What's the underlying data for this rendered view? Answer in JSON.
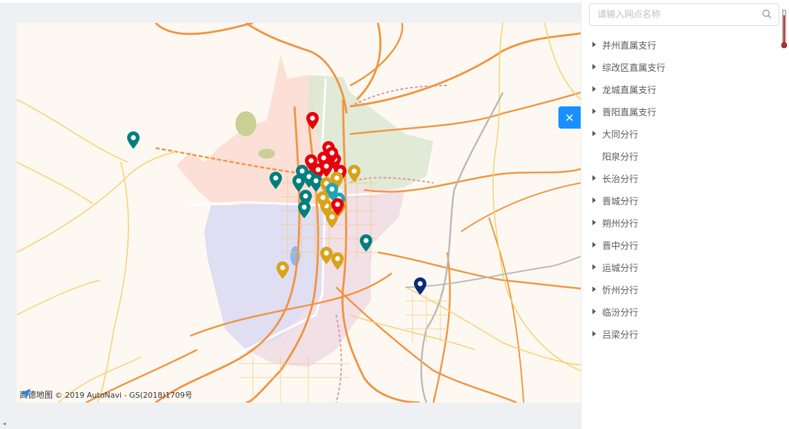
{
  "map": {
    "attribution_logo": "高德地图",
    "attribution_text": "© 2019 AutoNavi - GS(2018)1709号",
    "marker_colors": {
      "red": "#e8000b",
      "teal": "#007f7f",
      "gold": "#d9a21b",
      "cyan": "#1aa5b8",
      "navy": "#0b2a7a"
    }
  },
  "panel": {
    "search_placeholder": "请输入网点名称",
    "search_icon": "search-icon",
    "collapse_icon": "close-icon",
    "items": [
      {
        "label": "并州直属支行",
        "expandable": true
      },
      {
        "label": "综改区直属支行",
        "expandable": true
      },
      {
        "label": "龙城直属支行",
        "expandable": true
      },
      {
        "label": "晋阳直属支行",
        "expandable": true
      },
      {
        "label": "大同分行",
        "expandable": true
      },
      {
        "label": "阳泉分行",
        "expandable": false
      },
      {
        "label": "长治分行",
        "expandable": true
      },
      {
        "label": "晋城分行",
        "expandable": true
      },
      {
        "label": "朔州分行",
        "expandable": true
      },
      {
        "label": "晋中分行",
        "expandable": true
      },
      {
        "label": "运城分行",
        "expandable": true
      },
      {
        "label": "忻州分行",
        "expandable": true
      },
      {
        "label": "临汾分行",
        "expandable": true
      },
      {
        "label": "吕梁分行",
        "expandable": true
      }
    ]
  }
}
